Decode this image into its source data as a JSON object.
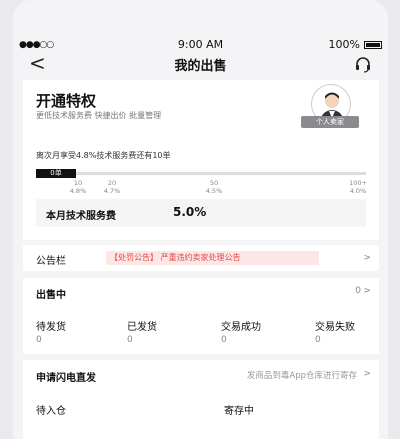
{
  "status_bar": {
    "signal": "●●●○○",
    "wifi": "wifi",
    "time": "9:00 AM",
    "battery": "100%"
  },
  "nav": {
    "back": "<",
    "title": "我的出售"
  },
  "privilege": {
    "title": "开通特权",
    "subtitle": "更低技术服务费  快捷出价  批量管理",
    "seller_tag": "个人卖家",
    "fee_note": "离次月享受4.8%技术服务费还有10单",
    "progress_label": "0单",
    "ticks": [
      {
        "count": "10",
        "rate": "4.8%"
      },
      {
        "count": "20",
        "rate": "4.7%"
      },
      {
        "count": "50",
        "rate": "4.5%"
      },
      {
        "count": "100+",
        "rate": "4.0%"
      }
    ],
    "fee_label": "本月技术服务费",
    "fee_value": "5.0%"
  },
  "notice": {
    "label": "公告栏",
    "text": "【处罚公告】 严重违约卖家处理公告",
    "chevron": ">"
  },
  "selling": {
    "title": "出售中",
    "count": "0",
    "chevron": ">",
    "stats": [
      {
        "label": "待发货",
        "value": "0"
      },
      {
        "label": "已发货",
        "value": "0"
      },
      {
        "label": "交易成功",
        "value": "0"
      },
      {
        "label": "交易失败",
        "value": "0"
      }
    ]
  },
  "flash": {
    "title": "申请闪电直发",
    "hint": "发商品到毒App仓库进行寄存",
    "chevron": ">",
    "items": [
      {
        "label": "待入仓"
      },
      {
        "label": "寄存中"
      }
    ]
  }
}
